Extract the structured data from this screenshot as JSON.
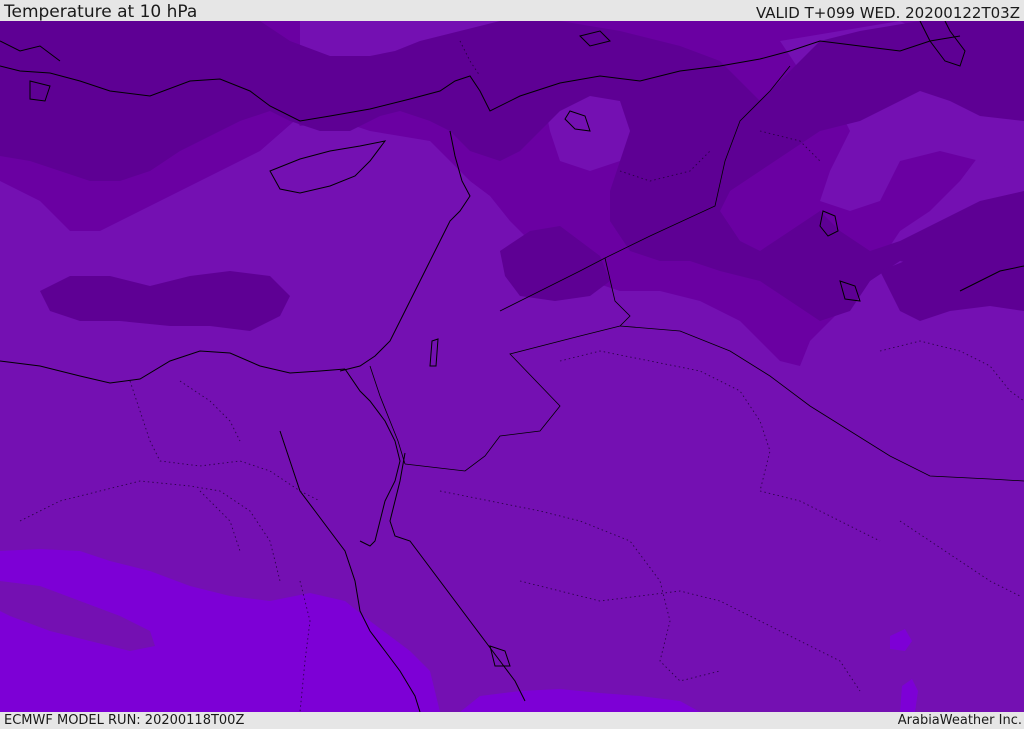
{
  "header": {
    "title": "Temperature at 10 hPa",
    "valid": "VALID T+099 WED. 20200122T03Z"
  },
  "footer": {
    "model_run": "ECMWF MODEL RUN: 20200118T00Z",
    "credit": "ArabiaWeather Inc."
  },
  "colors": {
    "background": "#e6e6e6",
    "band_darkest": "#5e0094",
    "band_dark": "#6a00a2",
    "band_mid": "#7410b2",
    "band_light": "#7d00d6",
    "coastline": "#000000"
  }
}
